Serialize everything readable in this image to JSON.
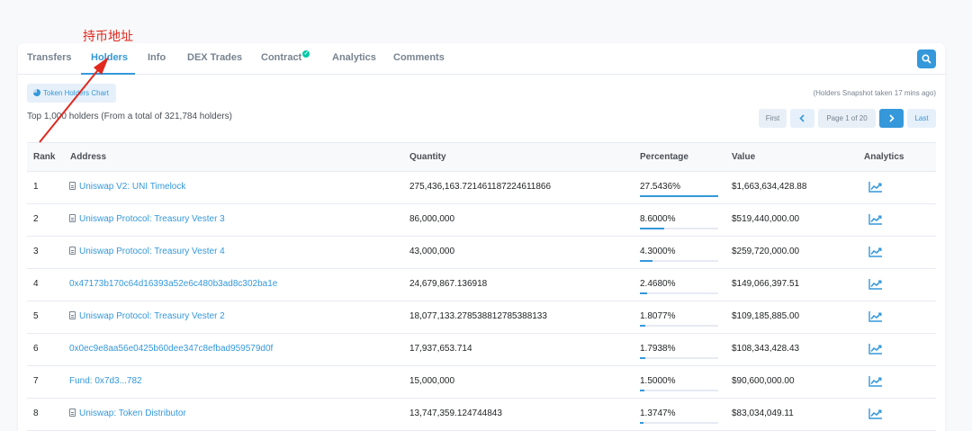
{
  "annotation": {
    "text": "持币地址",
    "color": "#e0281e"
  },
  "tabs": [
    {
      "label": "Transfers",
      "active": false
    },
    {
      "label": "Holders",
      "active": true
    },
    {
      "label": "Info",
      "active": false
    },
    {
      "label": "DEX Trades",
      "active": false
    },
    {
      "label": "Contract",
      "active": false,
      "verified_icon": "check-circle-icon"
    },
    {
      "label": "Analytics",
      "active": false
    },
    {
      "label": "Comments",
      "active": false
    }
  ],
  "search": {
    "icon": "search-icon"
  },
  "chart_button": {
    "label": "Token Holders Chart",
    "icon": "pie-chart-icon"
  },
  "snapshot_text": "(Holders Snapshot taken 17 mins ago)",
  "summary_text": "Top 1,000 holders (From a total of 321,784 holders)",
  "pagination": {
    "first": "First",
    "prev_icon": "chevron-left-icon",
    "page": "Page 1 of 20",
    "next_icon": "chevron-right-icon",
    "last": "Last"
  },
  "table": {
    "headers": {
      "rank": "Rank",
      "address": "Address",
      "quantity": "Quantity",
      "percentage": "Percentage",
      "value": "Value",
      "analytics": "Analytics"
    },
    "rows": [
      {
        "rank": "1",
        "address": "Uniswap V2: UNI Timelock",
        "contract": true,
        "quantity": "275,436,163.721461187224611866",
        "percentage": "27.5436%",
        "pct": 27.5436,
        "value": "$1,663,634,428.88"
      },
      {
        "rank": "2",
        "address": "Uniswap Protocol: Treasury Vester 3",
        "contract": true,
        "quantity": "86,000,000",
        "percentage": "8.6000%",
        "pct": 8.6,
        "value": "$519,440,000.00"
      },
      {
        "rank": "3",
        "address": "Uniswap Protocol: Treasury Vester 4",
        "contract": true,
        "quantity": "43,000,000",
        "percentage": "4.3000%",
        "pct": 4.3,
        "value": "$259,720,000.00"
      },
      {
        "rank": "4",
        "address": "0x47173b170c64d16393a52e6c480b3ad8c302ba1e",
        "contract": false,
        "quantity": "24,679,867.136918",
        "percentage": "2.4680%",
        "pct": 2.468,
        "value": "$149,066,397.51"
      },
      {
        "rank": "5",
        "address": "Uniswap Protocol: Treasury Vester 2",
        "contract": true,
        "quantity": "18,077,133.278538812785388133",
        "percentage": "1.8077%",
        "pct": 1.8077,
        "value": "$109,185,885.00"
      },
      {
        "rank": "6",
        "address": "0x0ec9e8aa56e0425b60dee347c8efbad959579d0f",
        "contract": false,
        "quantity": "17,937,653.714",
        "percentage": "1.7938%",
        "pct": 1.7938,
        "value": "$108,343,428.43"
      },
      {
        "rank": "7",
        "address": "Fund: 0x7d3...782",
        "contract": false,
        "quantity": "15,000,000",
        "percentage": "1.5000%",
        "pct": 1.5,
        "value": "$90,600,000.00"
      },
      {
        "rank": "8",
        "address": "Uniswap: Token Distributor",
        "contract": true,
        "quantity": "13,747,359.124744843",
        "percentage": "1.3747%",
        "pct": 1.3747,
        "value": "$83,034,049.11"
      }
    ]
  },
  "colors": {
    "accent": "#3498db",
    "text": "#1e2022",
    "muted": "#77838f",
    "annotation": "#e0281e"
  }
}
